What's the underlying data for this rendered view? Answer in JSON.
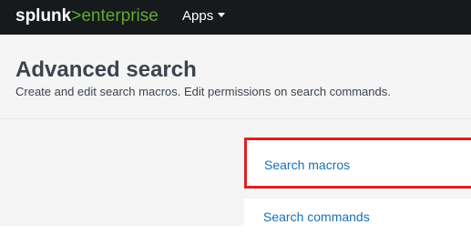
{
  "topbar": {
    "logo_brand": "splunk",
    "logo_separator": ">",
    "logo_product": "enterprise",
    "apps_label": "Apps"
  },
  "page": {
    "title": "Advanced search",
    "description": "Create and edit search macros. Edit permissions on search commands."
  },
  "links": [
    {
      "label": "Search macros",
      "highlighted": true
    },
    {
      "label": "Search commands",
      "highlighted": false
    }
  ],
  "colors": {
    "topbar_bg": "#171a1c",
    "brand_green": "#65a637",
    "link_blue": "#1a6fb5",
    "highlight_red": "#e02020",
    "page_bg": "#f5f5f5"
  }
}
